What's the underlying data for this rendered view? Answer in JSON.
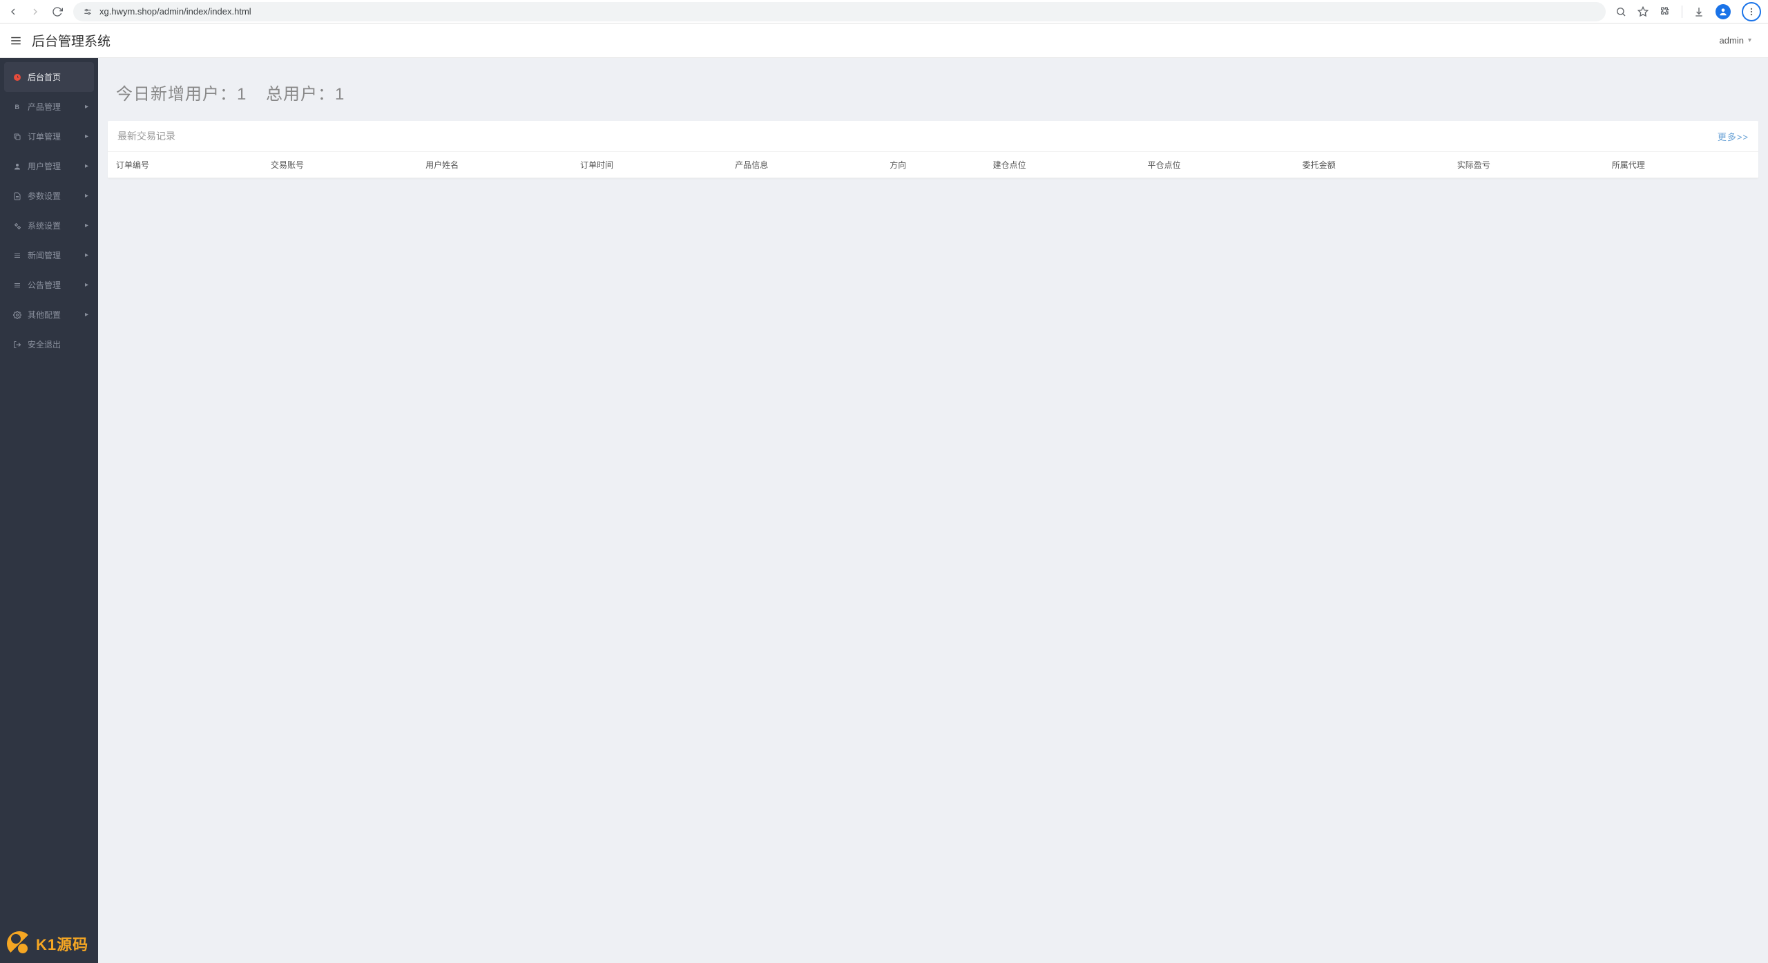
{
  "browser": {
    "url": "xg.hwym.shop/admin/index/index.html"
  },
  "header": {
    "title": "后台管理系统",
    "user": "admin"
  },
  "sidebar": {
    "items": [
      {
        "label": "后台首页",
        "icon": "dashboard",
        "active": true,
        "expandable": false
      },
      {
        "label": "产品管理",
        "icon": "bitcoin",
        "active": false,
        "expandable": true
      },
      {
        "label": "订单管理",
        "icon": "copy",
        "active": false,
        "expandable": true
      },
      {
        "label": "用户管理",
        "icon": "user",
        "active": false,
        "expandable": true
      },
      {
        "label": "参数设置",
        "icon": "file",
        "active": false,
        "expandable": true
      },
      {
        "label": "系统设置",
        "icon": "cogs",
        "active": false,
        "expandable": true
      },
      {
        "label": "新闻管理",
        "icon": "list",
        "active": false,
        "expandable": true
      },
      {
        "label": "公告管理",
        "icon": "list",
        "active": false,
        "expandable": true
      },
      {
        "label": "其他配置",
        "icon": "gear",
        "active": false,
        "expandable": true
      },
      {
        "label": "安全退出",
        "icon": "signout",
        "active": false,
        "expandable": false
      }
    ]
  },
  "stats": {
    "today_label": "今日新增用户：",
    "today_count": "1",
    "total_label": "总用户：",
    "total_count": "1"
  },
  "card": {
    "title": "最新交易记录",
    "more": "更多>>",
    "columns": [
      "订单编号",
      "交易账号",
      "用户姓名",
      "订单时间",
      "产品信息",
      "方向",
      "建仓点位",
      "平仓点位",
      "委托金额",
      "实际盈亏",
      "所属代理"
    ]
  },
  "watermark": {
    "text": "K1源码"
  }
}
